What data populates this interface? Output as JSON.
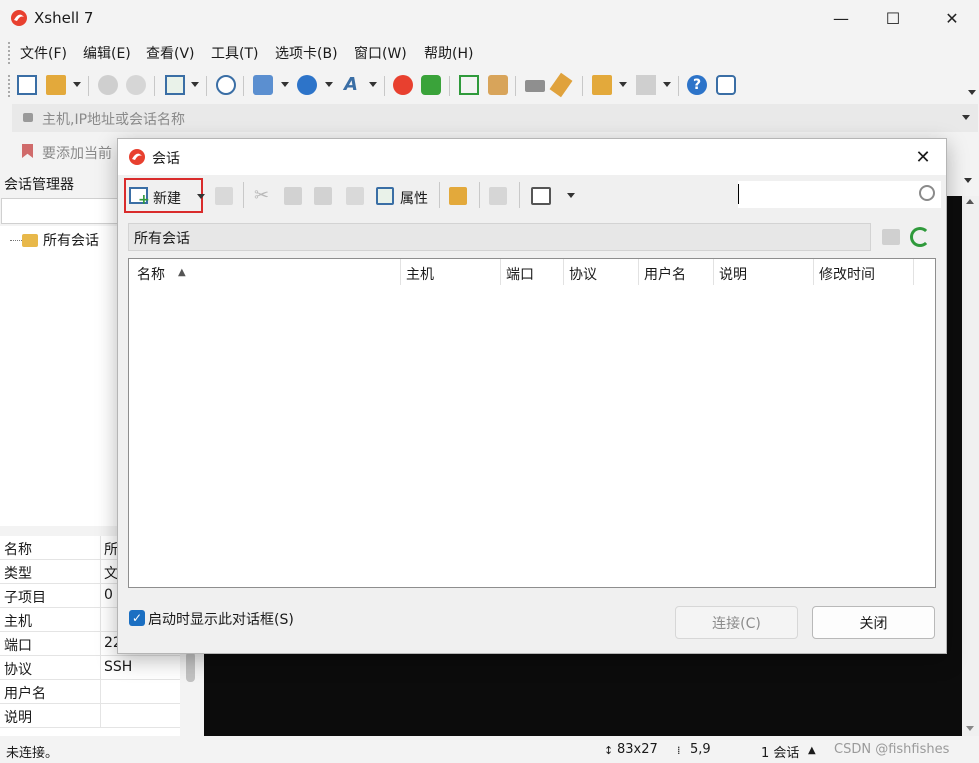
{
  "app": {
    "title": "Xshell 7"
  },
  "window_controls": {
    "minimize": "—",
    "maximize": "☐",
    "close": "✕"
  },
  "menu": [
    "文件(F)",
    "编辑(E)",
    "查看(V)",
    "工具(T)",
    "选项卡(B)",
    "窗口(W)",
    "帮助(H)"
  ],
  "address_bar": {
    "placeholder": "主机,IP地址或会话名称"
  },
  "link_bar": {
    "text": "要添加当前"
  },
  "session_manager": {
    "title": "会话管理器",
    "tree": [
      {
        "label": "所有会话"
      }
    ],
    "properties": [
      {
        "key": "名称",
        "value": "所"
      },
      {
        "key": "类型",
        "value": "文"
      },
      {
        "key": "子项目",
        "value": "0"
      },
      {
        "key": "主机",
        "value": ""
      },
      {
        "key": "端口",
        "value": "22"
      },
      {
        "key": "协议",
        "value": "SSH"
      },
      {
        "key": "用户名",
        "value": ""
      },
      {
        "key": "说明",
        "value": ""
      }
    ]
  },
  "status": {
    "connection": "未连接。",
    "size": "83x27",
    "cursor": "5,9",
    "sessions": "1 会话",
    "watermark": "CSDN @fishfishes"
  },
  "dialog": {
    "title": "会话",
    "new_label": "新建",
    "properties_label": "属性",
    "path": "所有会话",
    "columns": [
      "名称",
      "主机",
      "端口",
      "协议",
      "用户名",
      "说明",
      "修改时间"
    ],
    "show_on_start": "启动时显示此对话框(S)",
    "show_on_start_checked": true,
    "connect_label": "连接(C)",
    "close_label": "关闭"
  },
  "colors": {
    "accent": "#1b6fc2",
    "highlight_border": "#d92b2b",
    "terminal_bg": "#0c0c0c"
  }
}
